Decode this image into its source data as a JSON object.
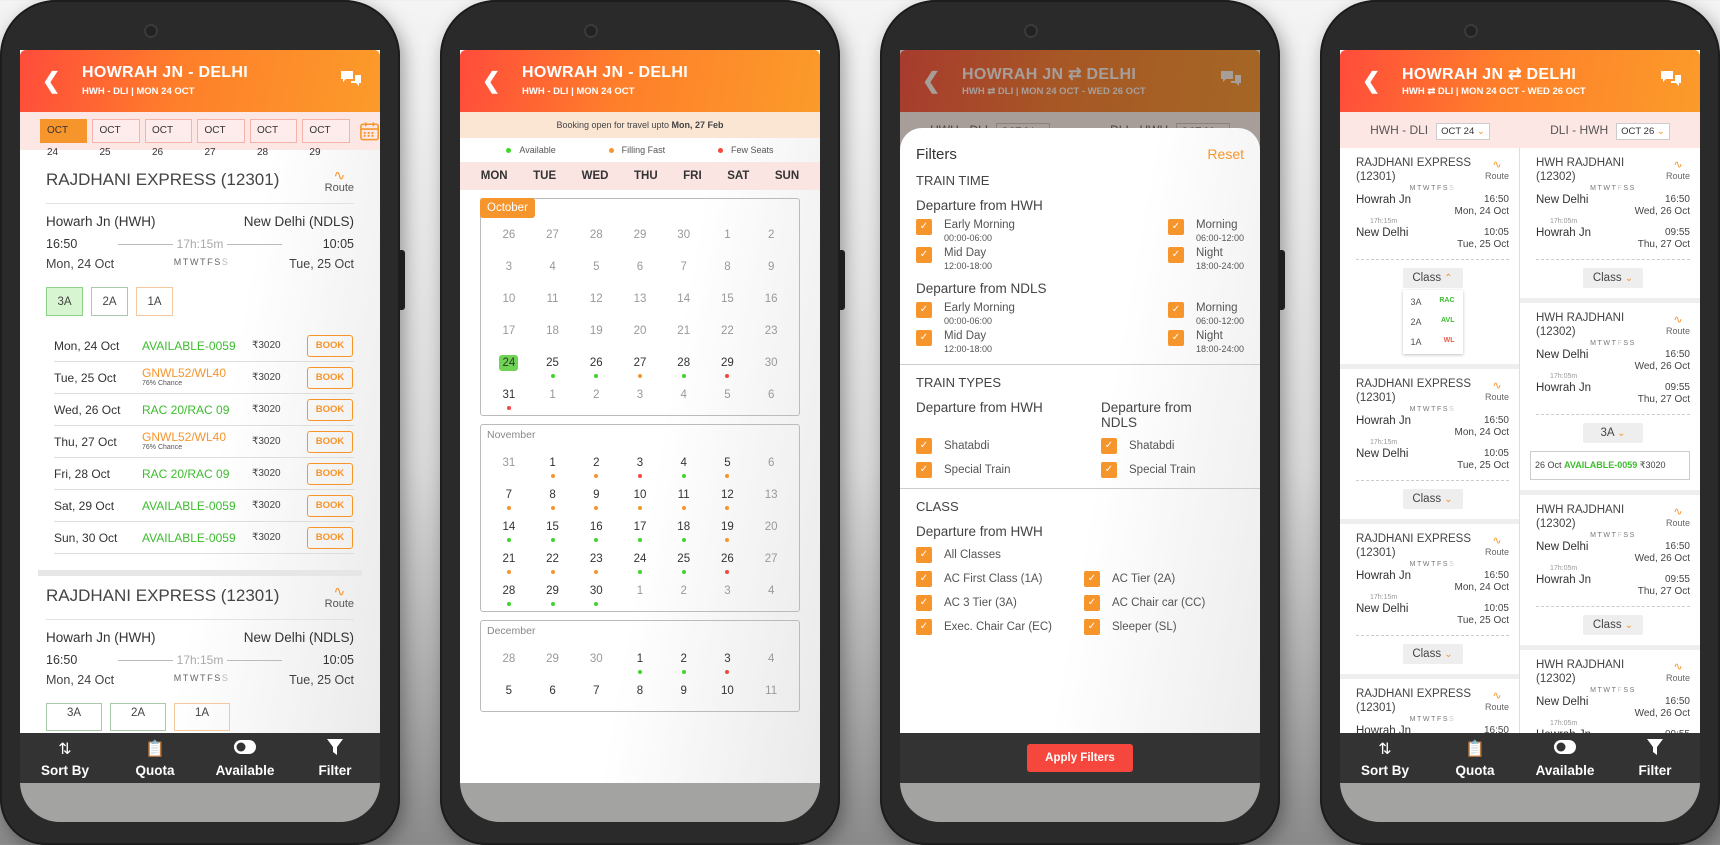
{
  "screens": [
    {
      "header": {
        "title": "HOWRAH JN - DELHI",
        "subtitle": "HWH - DLI  |  MON 24 OCT"
      },
      "date_chips": [
        "OCT 24",
        "OCT 25",
        "OCT 26",
        "OCT 27",
        "OCT 28",
        "OCT 29"
      ],
      "selected_date": "OCT 24",
      "trains": [
        {
          "name": "RAJDHANI EXPRESS (12301)",
          "route_label": "Route",
          "from": "Howarh Jn (HWH)",
          "to": "New Delhi (NDLS)",
          "dep_time": "16:50",
          "arr_time": "10:05",
          "duration": "17h:15m",
          "dep_date": "Mon, 24 Oct",
          "arr_date": "Tue, 25 Oct",
          "run_days": "MTWTFS",
          "run_days_off": "S",
          "classes": [
            "3A",
            "2A",
            "1A"
          ],
          "selected_class": "3A",
          "availability": [
            {
              "date": "Mon, 24 Oct",
              "status": "AVAILABLE-0059",
              "chance": "",
              "color": "green",
              "fare": "₹3020",
              "action": "BOOK"
            },
            {
              "date": "Tue, 25 Oct",
              "status": "GNWL52/WL40",
              "chance": "76% Chance",
              "color": "orange",
              "fare": "₹3020",
              "action": "BOOK"
            },
            {
              "date": "Wed, 26 Oct",
              "status": "RAC 20/RAC 09",
              "chance": "",
              "color": "green",
              "fare": "₹3020",
              "action": "BOOK"
            },
            {
              "date": "Thu, 27 Oct",
              "status": "GNWL52/WL40",
              "chance": "76% Chance",
              "color": "orange",
              "fare": "₹3020",
              "action": "BOOK"
            },
            {
              "date": "Fri, 28 Oct",
              "status": "RAC 20/RAC 09",
              "chance": "",
              "color": "green",
              "fare": "₹3020",
              "action": "BOOK"
            },
            {
              "date": "Sat, 29 Oct",
              "status": "AVAILABLE-0059",
              "chance": "",
              "color": "green",
              "fare": "₹3020",
              "action": "BOOK"
            },
            {
              "date": "Sun, 30 Oct",
              "status": "AVAILABLE-0059",
              "chance": "",
              "color": "green",
              "fare": "₹3020",
              "action": "BOOK"
            }
          ]
        },
        {
          "name": "RAJDHANI EXPRESS (12301)",
          "route_label": "Route",
          "from": "Howarh Jn (HWH)",
          "to": "New Delhi (NDLS)",
          "dep_time": "16:50",
          "arr_time": "10:05",
          "duration": "17h:15m",
          "dep_date": "Mon, 24 Oct",
          "arr_date": "Tue, 25 Oct",
          "run_days": "MTWTFS",
          "run_days_off": "S",
          "classes": [
            "3A",
            "2A",
            "1A"
          ]
        }
      ],
      "bottom_bar": [
        {
          "label": "Sort By",
          "icon": "sort-icon"
        },
        {
          "label": "Quota",
          "icon": "clipboard-icon"
        },
        {
          "label": "Available",
          "icon": "toggle-icon"
        },
        {
          "label": "Filter",
          "icon": "filter-icon"
        }
      ]
    },
    {
      "header": {
        "title": "HOWRAH JN - DELHI",
        "subtitle": "HWH - DLI  |  MON 24 OCT"
      },
      "banner": {
        "text": "Booking open for travel upto ",
        "highlight": "Mon, 27 Feb"
      },
      "legend": [
        {
          "label": "Available",
          "color": "#3fd62a"
        },
        {
          "label": "Filling Fast",
          "color": "#f6952b"
        },
        {
          "label": "Few Seats",
          "color": "#f5473d"
        }
      ],
      "weekdays": [
        "MON",
        "TUE",
        "WED",
        "THU",
        "FRI",
        "SAT",
        "SUN"
      ],
      "months": [
        {
          "name": "October",
          "style": "tag",
          "days": [
            {
              "d": "26",
              "a": 0
            },
            {
              "d": "27",
              "a": 0
            },
            {
              "d": "28",
              "a": 0
            },
            {
              "d": "29",
              "a": 0
            },
            {
              "d": "30",
              "a": 0
            },
            {
              "d": "1",
              "a": 0
            },
            {
              "d": "2",
              "a": 0
            },
            {
              "d": "3",
              "a": 0
            },
            {
              "d": "4",
              "a": 0
            },
            {
              "d": "5",
              "a": 0
            },
            {
              "d": "6",
              "a": 0
            },
            {
              "d": "7",
              "a": 0
            },
            {
              "d": "8",
              "a": 0
            },
            {
              "d": "9",
              "a": 0
            },
            {
              "d": "10",
              "a": 0
            },
            {
              "d": "11",
              "a": 0
            },
            {
              "d": "12",
              "a": 0
            },
            {
              "d": "13",
              "a": 0
            },
            {
              "d": "14",
              "a": 0
            },
            {
              "d": "15",
              "a": 0
            },
            {
              "d": "16",
              "a": 0
            },
            {
              "d": "17",
              "a": 0
            },
            {
              "d": "18",
              "a": 0
            },
            {
              "d": "19",
              "a": 0
            },
            {
              "d": "20",
              "a": 0
            },
            {
              "d": "21",
              "a": 0
            },
            {
              "d": "22",
              "a": 0
            },
            {
              "d": "23",
              "a": 0
            },
            {
              "d": "24",
              "a": 1,
              "today": true
            },
            {
              "d": "25",
              "a": 1,
              "s": "g"
            },
            {
              "d": "26",
              "a": 1,
              "s": "g"
            },
            {
              "d": "27",
              "a": 1,
              "s": "o"
            },
            {
              "d": "28",
              "a": 1,
              "s": "g"
            },
            {
              "d": "29",
              "a": 1,
              "s": "r"
            },
            {
              "d": "30",
              "a": 0
            },
            {
              "d": "31",
              "a": 1,
              "s": "r"
            },
            {
              "d": "1",
              "a": 0
            },
            {
              "d": "2",
              "a": 0
            },
            {
              "d": "3",
              "a": 0
            },
            {
              "d": "4",
              "a": 0
            },
            {
              "d": "5",
              "a": 0
            },
            {
              "d": "6",
              "a": 0
            }
          ]
        },
        {
          "name": "November",
          "style": "label",
          "days": [
            {
              "d": "31",
              "a": 0
            },
            {
              "d": "1",
              "a": 1,
              "s": "o"
            },
            {
              "d": "2",
              "a": 1,
              "s": "o"
            },
            {
              "d": "3",
              "a": 1,
              "s": "r"
            },
            {
              "d": "4",
              "a": 1,
              "s": "g"
            },
            {
              "d": "5",
              "a": 1,
              "s": "o"
            },
            {
              "d": "6",
              "a": 0
            },
            {
              "d": "7",
              "a": 1,
              "s": "o"
            },
            {
              "d": "8",
              "a": 1,
              "s": "o"
            },
            {
              "d": "9",
              "a": 1,
              "s": "o"
            },
            {
              "d": "10",
              "a": 1,
              "s": "o"
            },
            {
              "d": "11",
              "a": 1,
              "s": "o"
            },
            {
              "d": "12",
              "a": 1,
              "s": "o"
            },
            {
              "d": "13",
              "a": 0
            },
            {
              "d": "14",
              "a": 1,
              "s": "g"
            },
            {
              "d": "15",
              "a": 1,
              "s": "g"
            },
            {
              "d": "16",
              "a": 1,
              "s": "g"
            },
            {
              "d": "17",
              "a": 1,
              "s": "g"
            },
            {
              "d": "18",
              "a": 1,
              "s": "g"
            },
            {
              "d": "19",
              "a": 1,
              "s": "o"
            },
            {
              "d": "20",
              "a": 0
            },
            {
              "d": "21",
              "a": 1,
              "s": "o"
            },
            {
              "d": "22",
              "a": 1,
              "s": "o"
            },
            {
              "d": "23",
              "a": 1,
              "s": "o"
            },
            {
              "d": "24",
              "a": 1,
              "s": "g"
            },
            {
              "d": "25",
              "a": 1,
              "s": "g"
            },
            {
              "d": "26",
              "a": 1,
              "s": "r"
            },
            {
              "d": "27",
              "a": 0
            },
            {
              "d": "28",
              "a": 1,
              "s": "g"
            },
            {
              "d": "29",
              "a": 1,
              "s": "g"
            },
            {
              "d": "30",
              "a": 1,
              "s": "g"
            },
            {
              "d": "1",
              "a": 0
            },
            {
              "d": "2",
              "a": 0
            },
            {
              "d": "3",
              "a": 0
            },
            {
              "d": "4",
              "a": 0
            }
          ]
        },
        {
          "name": "December",
          "style": "label",
          "days": [
            {
              "d": "28",
              "a": 0
            },
            {
              "d": "29",
              "a": 0
            },
            {
              "d": "30",
              "a": 0
            },
            {
              "d": "1",
              "a": 1,
              "s": "g"
            },
            {
              "d": "2",
              "a": 1,
              "s": "g"
            },
            {
              "d": "3",
              "a": 1,
              "s": "r"
            },
            {
              "d": "4",
              "a": 0
            },
            {
              "d": "5",
              "a": 1
            },
            {
              "d": "6",
              "a": 1
            },
            {
              "d": "7",
              "a": 1
            },
            {
              "d": "8",
              "a": 1
            },
            {
              "d": "9",
              "a": 1
            },
            {
              "d": "10",
              "a": 1
            },
            {
              "d": "11",
              "a": 0
            }
          ]
        }
      ]
    },
    {
      "header": {
        "title": "HOWRAH JN ⇄ DELHI",
        "subtitle": "HWH ⇄ DLI  |  MON 24 OCT - WED 26 OCT"
      },
      "legs": [
        {
          "label": "HWH - DLI",
          "date": "OCT 24"
        },
        {
          "label": "DLI - HWH",
          "date": "OCT 26"
        }
      ],
      "filters": {
        "title": "Filters",
        "reset": "Reset",
        "train_time": {
          "heading": "TRAIN TIME",
          "groups": [
            {
              "title": "Departure from HWH",
              "options": [
                {
                  "label": "Early Morning",
                  "range": "00:00-06:00",
                  "checked": true
                },
                {
                  "label": "Morning",
                  "range": "06:00-12:00",
                  "checked": true
                },
                {
                  "label": "Mid Day",
                  "range": "12:00-18:00",
                  "checked": true
                },
                {
                  "label": "Night",
                  "range": "18:00-24:00",
                  "checked": true
                }
              ]
            },
            {
              "title": "Departure from NDLS",
              "options": [
                {
                  "label": "Early Morning",
                  "range": "00:00-06:00",
                  "checked": true
                },
                {
                  "label": "Morning",
                  "range": "06:00-12:00",
                  "checked": true
                },
                {
                  "label": "Mid Day",
                  "range": "12:00-18:00",
                  "checked": true
                },
                {
                  "label": "Night",
                  "range": "18:00-24:00",
                  "checked": true
                }
              ]
            }
          ]
        },
        "train_types": {
          "heading": "TRAIN TYPES",
          "col1_title": "Departure from HWH",
          "col2_title": "Departure from NDLS",
          "col1": [
            {
              "label": "Shatabdi",
              "checked": true
            },
            {
              "label": "Special Train",
              "checked": true
            }
          ],
          "col2": [
            {
              "label": "Shatabdi",
              "checked": true
            },
            {
              "label": "Special Train",
              "checked": true
            }
          ]
        },
        "class": {
          "heading": "CLASS",
          "group_title": "Departure from HWH",
          "all": {
            "label": "All Classes",
            "checked": true
          },
          "options": [
            {
              "label": "AC First Class (1A)",
              "checked": true
            },
            {
              "label": "AC Tier (2A)",
              "checked": true
            },
            {
              "label": "AC 3 Tier (3A)",
              "checked": true
            },
            {
              "label": "AC Chair car (CC)",
              "checked": true
            },
            {
              "label": "Exec. Chair Car (EC)",
              "checked": true
            },
            {
              "label": "Sleeper (SL)",
              "checked": true
            }
          ]
        },
        "apply": "Apply Filters"
      }
    },
    {
      "header": {
        "title": "HOWRAH JN ⇄ DELHI",
        "subtitle": "HWH ⇄ DLI  |  MON 24 OCT - WED 26 OCT"
      },
      "legs": [
        {
          "label": "HWH - DLI",
          "date": "OCT 24"
        },
        {
          "label": "DLI - HWH",
          "date": "OCT 26"
        }
      ],
      "outbound": {
        "name": "RAJDHANI EXPRESS (12301)",
        "route": "Route",
        "days": "MTWTFS",
        "days_off": "S",
        "from": "Howrah Jn",
        "to": "New Delhi",
        "dep": "16:50",
        "dep_date": "Mon, 24 Oct",
        "arr": "10:05",
        "arr_date": "Tue, 25 Oct",
        "duration": "17h:15m",
        "class_btn": "Class",
        "class_dropdown": [
          {
            "cls": "3A",
            "status": "RAC",
            "color": "green"
          },
          {
            "cls": "2A",
            "status": "AVL",
            "color": "green"
          },
          {
            "cls": "1A",
            "status": "WL",
            "color": "red"
          }
        ]
      },
      "inbound": {
        "name": "HWH RAJDHANI (12302)",
        "route": "Route",
        "days": "MTWT",
        "days_off": "F",
        "days_tail": "SS",
        "from": "New Delhi",
        "to": "Howrah Jn",
        "dep": "16:50",
        "dep_date": "Wed, 26 Oct",
        "arr": "09:55",
        "arr_date": "Thu, 27 Oct",
        "duration": "17h:05m",
        "class_btn": "Class",
        "selected_class": "3A",
        "availability": {
          "date": "26 Oct",
          "status": "AVAILABLE-0059",
          "fare": "₹3020"
        }
      },
      "bottom_bar": [
        {
          "label": "Sort By"
        },
        {
          "label": "Quota"
        },
        {
          "label": "Available"
        },
        {
          "label": "Filter"
        }
      ]
    }
  ]
}
